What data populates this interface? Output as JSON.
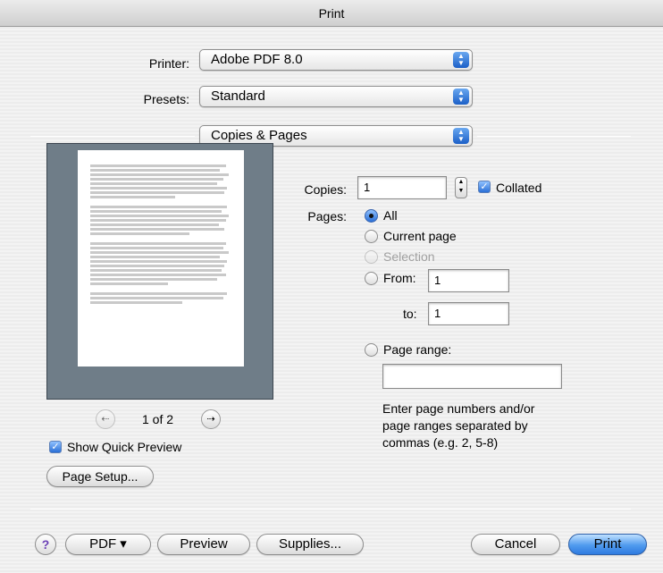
{
  "window": {
    "title": "Print"
  },
  "printer": {
    "label": "Printer:",
    "value": "Adobe PDF 8.0"
  },
  "presets": {
    "label": "Presets:",
    "value": "Standard"
  },
  "panel": {
    "value": "Copies & Pages"
  },
  "preview": {
    "page_indicator": "1 of 2",
    "show_quick_preview_label": "Show Quick Preview",
    "show_quick_preview_checked": true
  },
  "page_setup_label": "Page Setup...",
  "copies": {
    "label": "Copies:",
    "value": "1",
    "collated_label": "Collated",
    "collated_checked": true
  },
  "pages": {
    "label": "Pages:",
    "all_label": "All",
    "current_label": "Current page",
    "selection_label": "Selection",
    "from_label": "From:",
    "from_value": "1",
    "to_label": "to:",
    "to_value": "1",
    "range_label": "Page range:",
    "range_value": "",
    "hint": "Enter page numbers and/or page ranges separated by commas (e.g. 2, 5-8)"
  },
  "footer": {
    "help_label": "?",
    "pdf_label": "PDF ▾",
    "preview_label": "Preview",
    "supplies_label": "Supplies...",
    "cancel_label": "Cancel",
    "print_label": "Print"
  },
  "colors": {
    "accent": "#2f7be0",
    "preview_bg": "#6f7d88"
  }
}
